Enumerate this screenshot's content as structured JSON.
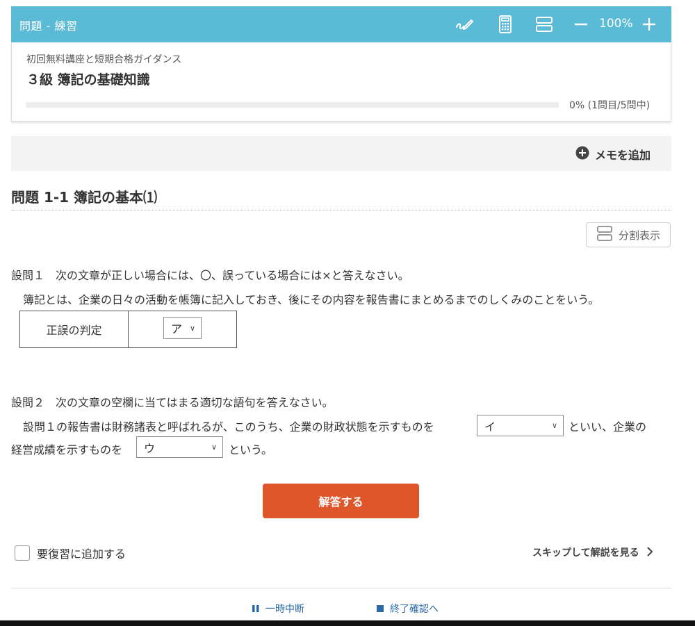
{
  "header": {
    "title": "問題 - 練習",
    "zoom": "100%",
    "icons": [
      "pen-icon",
      "calculator-icon",
      "split-layout-icon",
      "zoom-out-icon",
      "zoom-in-icon"
    ],
    "background_color": "#5bbad6"
  },
  "course": {
    "name": "初回無料講座と短期合格ガイダンス",
    "lesson": "３級 簿記の基礎知識",
    "progress_text": "0% (1問目/5問中)",
    "progress_fraction": 0
  },
  "memo": {
    "label": "メモを追加"
  },
  "question": {
    "title": "問題 1-1 簿記の基本⑴",
    "split_label": "分割表示",
    "q1_prompt": "設問１　次の文章が正しい場合には、〇、誤っている場合には×と答えなさい。",
    "q1_body": "簿記とは、企業の日々の活動を帳簿に記入しておき、後にその内容を報告書にまとめるまでのしくみのことをいう。",
    "q1_table_label": "正誤の判定",
    "q1_select_value": "ア",
    "q2_prompt": "設問２　次の文章の空欄に当てはまる適切な語句を答えなさい。",
    "q2_text_1": "設問１の報告書は財務諸表と呼ばれるが、このうち、企業の財政状態を示すものを",
    "q2_select_1": "イ",
    "q2_text_2": "といい、企業の",
    "q2_text_3": "経営成績を示すものを",
    "q2_select_2": "ウ",
    "q2_text_4": "という。"
  },
  "actions": {
    "answer_label": "解答する",
    "answer_color": "#e0562b",
    "review_label": "要復習に追加する",
    "skip_label": "スキップして解説を見る",
    "pause_label": "一時中断",
    "finish_label": "終了確認へ"
  }
}
